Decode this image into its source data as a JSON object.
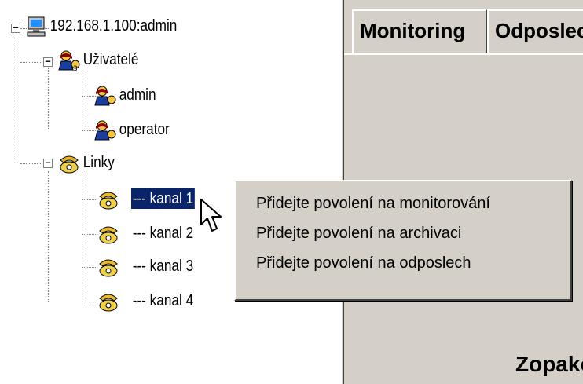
{
  "tree": {
    "root": {
      "label": "192.168.1.100:admin",
      "toggle": "−"
    },
    "users": {
      "label": "Uživatelé",
      "toggle": "−"
    },
    "user_items": [
      {
        "label": "admin"
      },
      {
        "label": "operator"
      }
    ],
    "lines": {
      "label": "Linky",
      "toggle": "−"
    },
    "channel_items": [
      {
        "label": "--- kanal 1",
        "selected": true
      },
      {
        "label": "--- kanal 2"
      },
      {
        "label": "--- kanal 3"
      },
      {
        "label": "--- kanal 4"
      }
    ]
  },
  "right_pane": {
    "tabs": [
      {
        "label": "Monitoring"
      },
      {
        "label": "Odposlech"
      }
    ],
    "bottom_text": "Zopakovat"
  },
  "context_menu": {
    "items": [
      {
        "label": "Přidejte povolení na monitorování"
      },
      {
        "label": "Přidejte povolení na archivaci"
      },
      {
        "label": "Přidejte povolení na odposlech"
      }
    ]
  },
  "colors": {
    "selection": "#0a246a",
    "face": "#d4d0c8"
  },
  "icons": {
    "server": "computer-icon",
    "group": "users-icon",
    "user": "user-icon",
    "phone": "phone-icon"
  }
}
